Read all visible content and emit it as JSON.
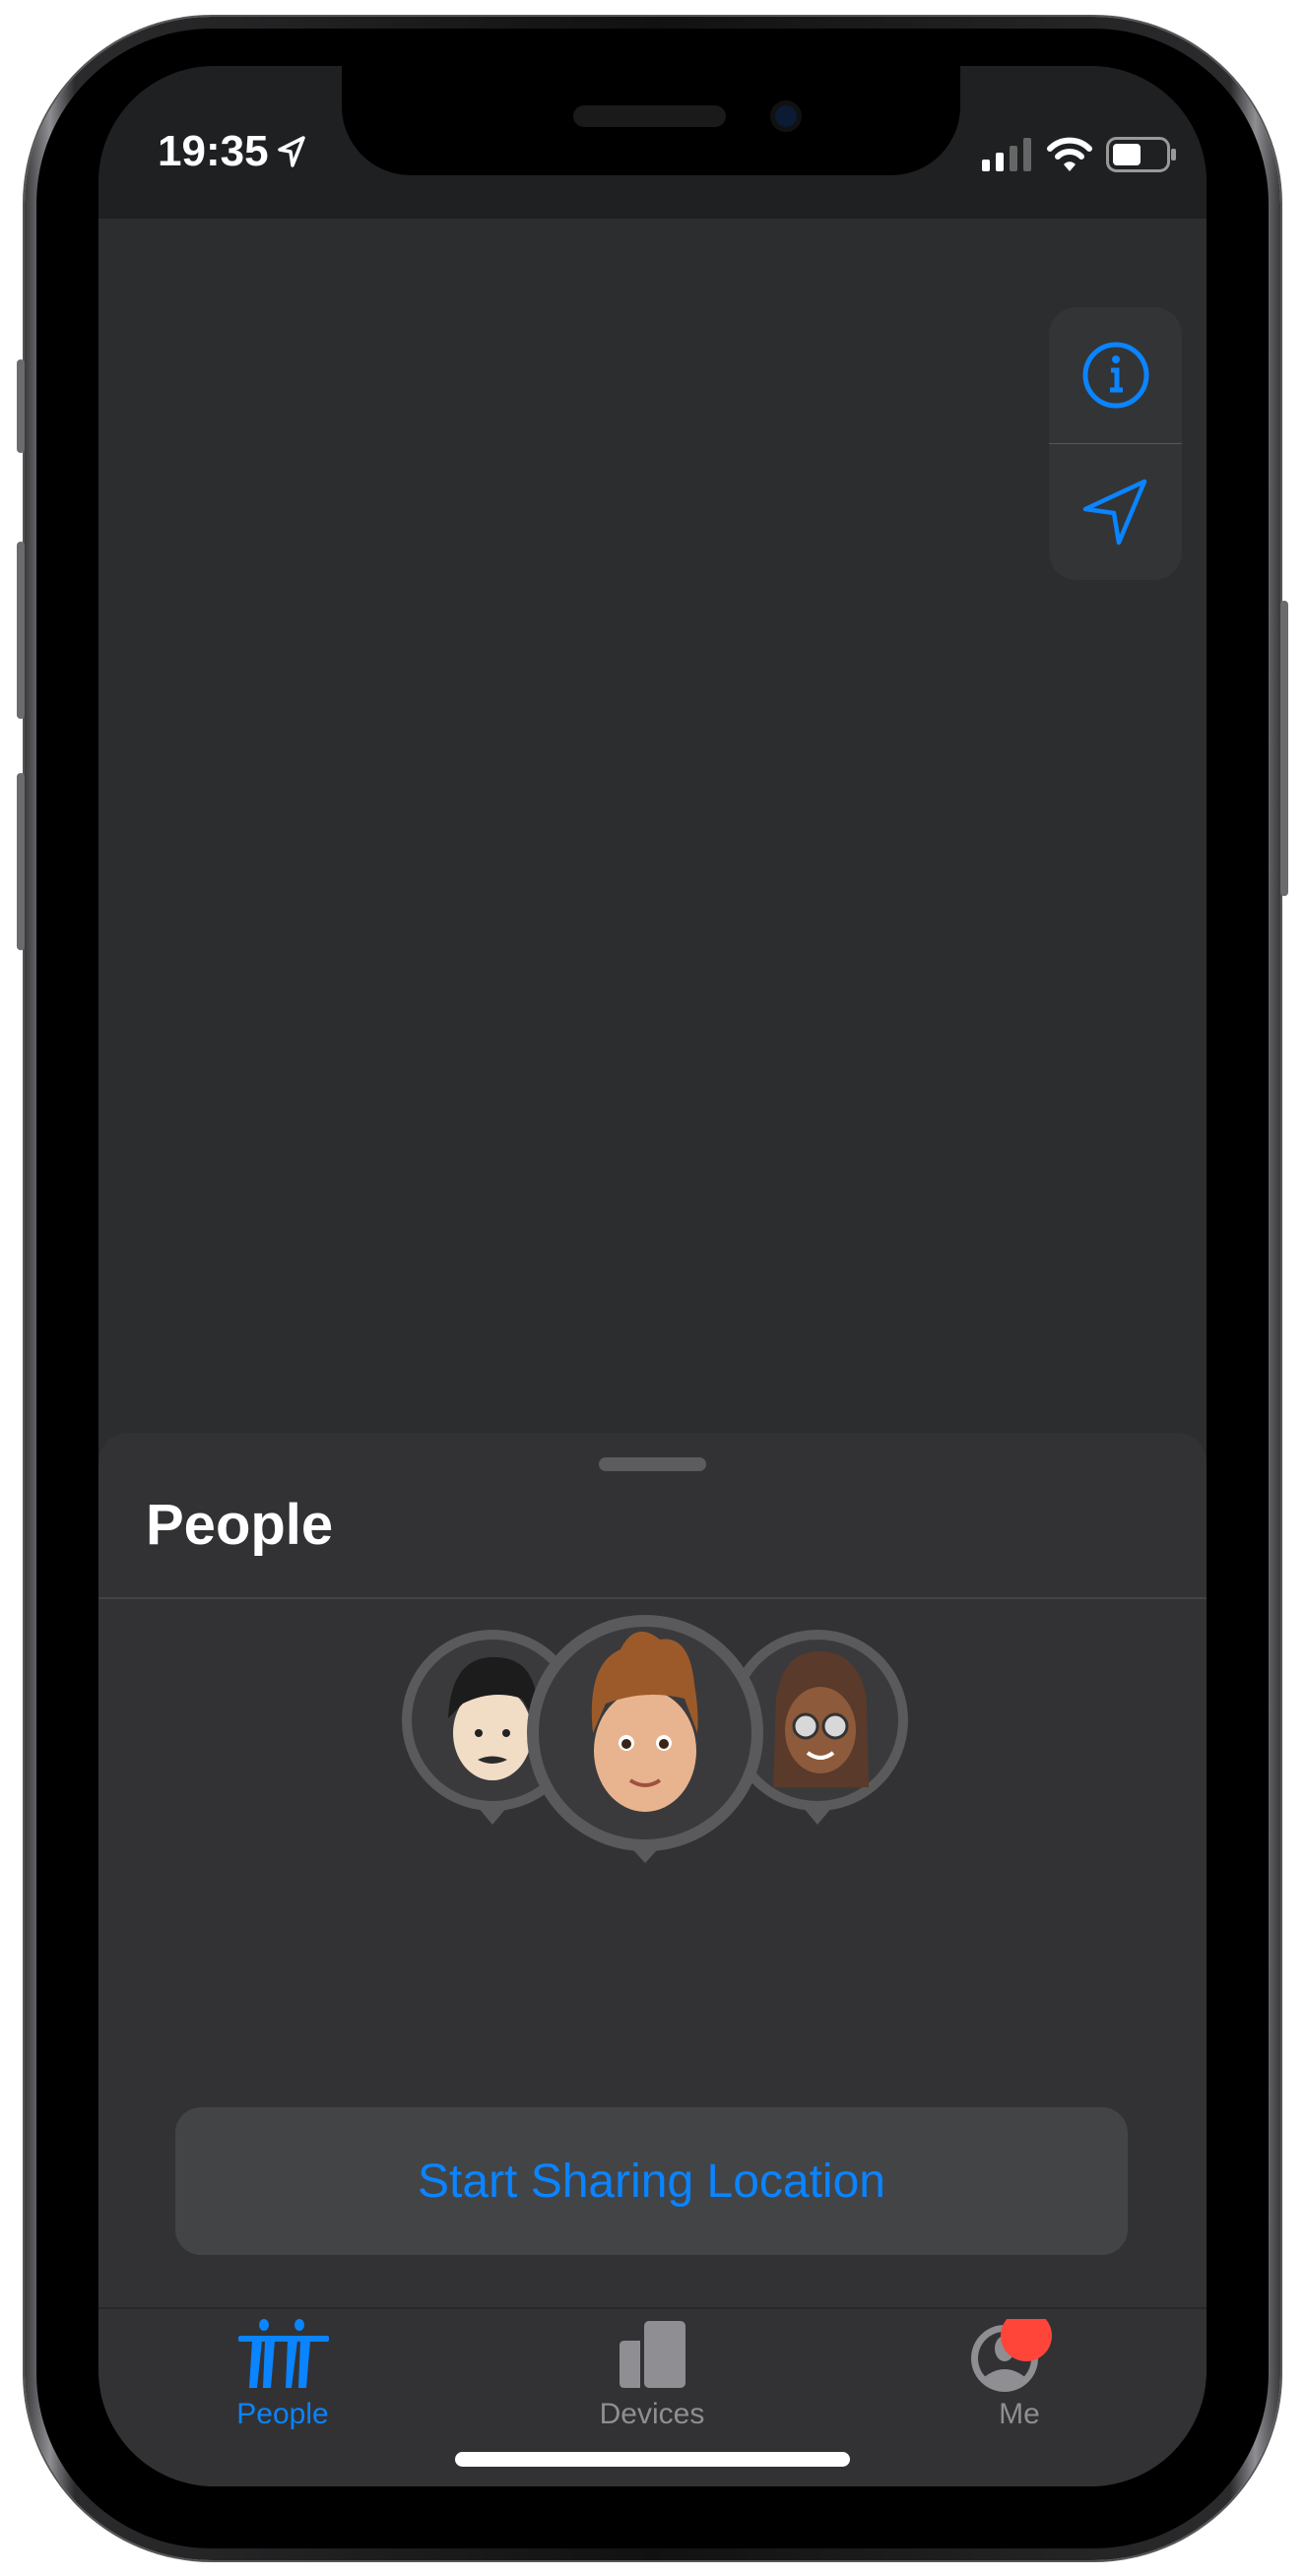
{
  "status_bar": {
    "time": "19:35",
    "icons": [
      "location-arrow-icon",
      "cellular-signal-icon",
      "wifi-icon",
      "battery-icon"
    ]
  },
  "map_controls": [
    {
      "icon": "info-icon"
    },
    {
      "icon": "location-arrow-icon"
    }
  ],
  "sheet": {
    "title": "People",
    "avatars": [
      "memoji-person-1",
      "memoji-person-2",
      "memoji-person-3"
    ],
    "button_label": "Start Sharing Location"
  },
  "tab_bar": {
    "items": [
      {
        "label": "People",
        "icon": "people-icon",
        "active": true
      },
      {
        "label": "Devices",
        "icon": "devices-icon",
        "active": false
      },
      {
        "label": "Me",
        "icon": "me-icon",
        "active": false,
        "badge": true
      }
    ]
  },
  "colors": {
    "accent": "#0a84ff",
    "badge": "#ff453a",
    "sheet": "#323234",
    "map": "#2c2d2f",
    "inactive": "#8e8e93"
  }
}
